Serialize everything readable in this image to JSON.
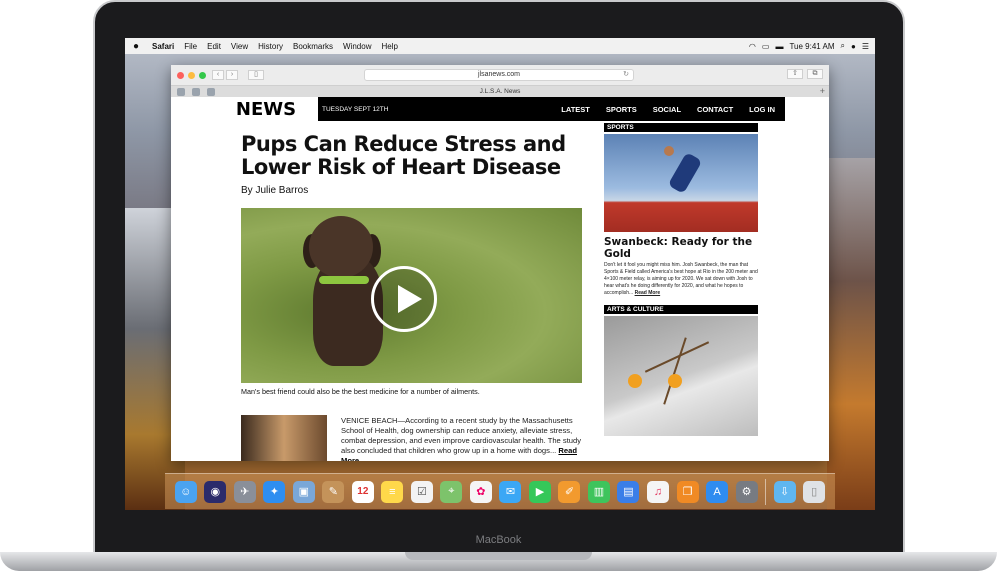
{
  "device": {
    "label": "MacBook"
  },
  "menubar": {
    "apple": "",
    "items": [
      "Safari",
      "File",
      "Edit",
      "View",
      "History",
      "Bookmarks",
      "Window",
      "Help"
    ],
    "clock": "Tue 9:41 AM"
  },
  "browser": {
    "url": "jlsanews.com",
    "tab_title": "J.L.S.A. News"
  },
  "page": {
    "logo": "NEWS",
    "date": "TUESDAY SEPT 12TH",
    "nav": [
      "LATEST",
      "SPORTS",
      "SOCIAL",
      "CONTACT",
      "LOG IN"
    ],
    "headline": "Pups Can Reduce Stress and Lower Risk of Heart Disease",
    "byline": "By Julie Barros",
    "caption": "Man's best friend could also be the best medicine for a number of ailments.",
    "story": "VENICE BEACH—According to a recent study by the Massachusetts School of Health, dog ownership can reduce anxiety, alleviate stress, combat depression, and even improve cardiovascular health. The study also concluded that children who grow up in a home with dogs...",
    "read_more": "Read More",
    "sidebar": {
      "sports_label": "SPORTS",
      "sports_title": "Swanbeck: Ready for the Gold",
      "sports_text": "Don't let it fool you might miss him. Josh Swanbeck, the man that Sports & Field called America's best hope at Rio in the 200 meter and 4×100 meter relay, is aiming up for 2020. We sat down with Josh to hear what's he doing differently for 2020, and what he hopes to accomplish...",
      "sports_more": "Read More",
      "arts_label": "ARTS & CULTURE"
    }
  },
  "dock": {
    "icons": [
      "finder-icon",
      "siri-icon",
      "launchpad-icon",
      "safari-icon",
      "photos-preview-icon",
      "contacts-icon",
      "calendar-icon",
      "notes-icon",
      "reminders-icon",
      "maps-icon",
      "photos-icon",
      "messages-icon",
      "facetime-icon",
      "pages-icon",
      "numbers-icon",
      "keynote-icon",
      "music-icon",
      "books-icon",
      "app-store-icon",
      "system-preferences-icon",
      "downloads-icon",
      "trash-icon"
    ],
    "calendar_day": "12"
  }
}
